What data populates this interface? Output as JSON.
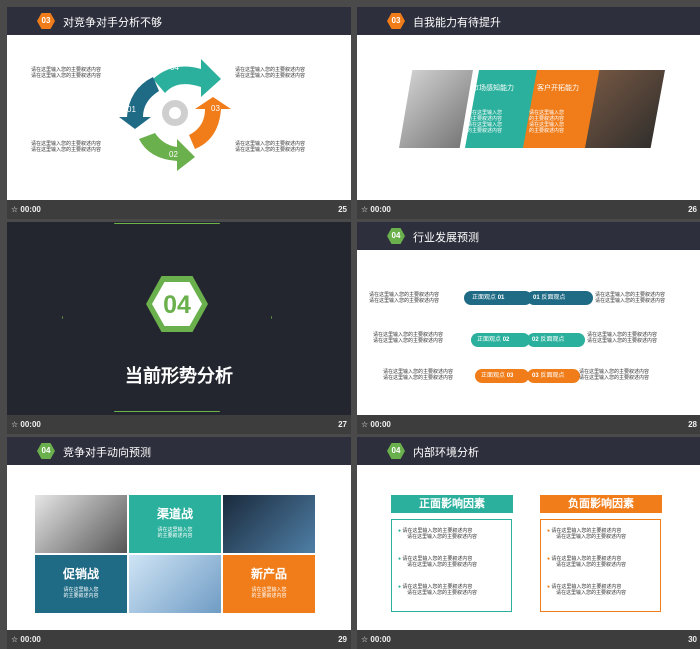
{
  "placeholder_text": "请在这里输入您的主要叙述内容",
  "placeholder_short1": "请在这里输入您",
  "placeholder_short2": "的主要叙述内容",
  "slides": [
    {
      "time": "00:00",
      "number": "25",
      "badge": "03",
      "title": "对竞争对手分析不够",
      "labels": [
        "01",
        "02",
        "03",
        "04"
      ]
    },
    {
      "time": "00:00",
      "number": "26",
      "badge": "03",
      "title": "自我能力有待提升",
      "panel1": "市场感知能力",
      "panel2": "客户开拓能力"
    },
    {
      "time": "00:00",
      "number": "27",
      "badge": "04",
      "title": "当前形势分析"
    },
    {
      "time": "00:00",
      "number": "28",
      "badge": "04",
      "title": "行业发展预测",
      "rows": [
        {
          "left": "正面观点",
          "lnum": "01",
          "rnum": "01",
          "right": "反面观点"
        },
        {
          "left": "正面观点",
          "lnum": "02",
          "rnum": "02",
          "right": "反面观点"
        },
        {
          "left": "正面观点",
          "lnum": "03",
          "rnum": "03",
          "right": "反面观点"
        }
      ]
    },
    {
      "time": "00:00",
      "number": "29",
      "badge": "04",
      "title": "竞争对手动向预测",
      "tiles": [
        "渠道战",
        "促销战",
        "新产品"
      ]
    },
    {
      "time": "00:00",
      "number": "30",
      "badge": "04",
      "title": "内部环境分析",
      "positive": "正面影响因素",
      "negative": "负面影响因素"
    }
  ],
  "colors": {
    "orange": "#f07d1a",
    "green": "#6ab04c",
    "teal": "#2ab09c",
    "navy": "#1f6b85",
    "dark": "#2d2f3c"
  }
}
